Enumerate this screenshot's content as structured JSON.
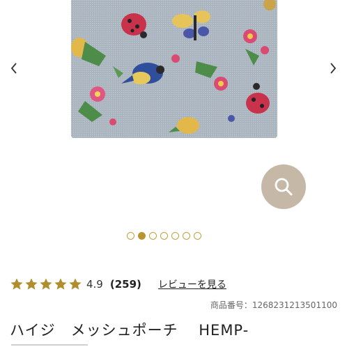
{
  "gallery": {
    "image_alt": "mesh pouch with cross-stitch birds, ladybugs, butterfly and flowers",
    "prev_icon": "chevron-left-icon",
    "next_icon": "chevron-right-icon",
    "zoom_icon": "search-icon",
    "slide_count": 7,
    "active_slide": 2,
    "colors": {
      "dot_active": "#b99531",
      "dot_border": "#c1a03c",
      "zoom_bg": "#c5b8a7"
    }
  },
  "rating": {
    "stars": 5,
    "star_icon": "star-icon",
    "star_color": "#b08d2e",
    "value": "4.9",
    "count": "(259)",
    "review_link": "レビューを見る"
  },
  "product": {
    "code_label": "商品番号：1268231213501100",
    "title": "ハイジ　メッシュポーチ　 HEMP-"
  }
}
